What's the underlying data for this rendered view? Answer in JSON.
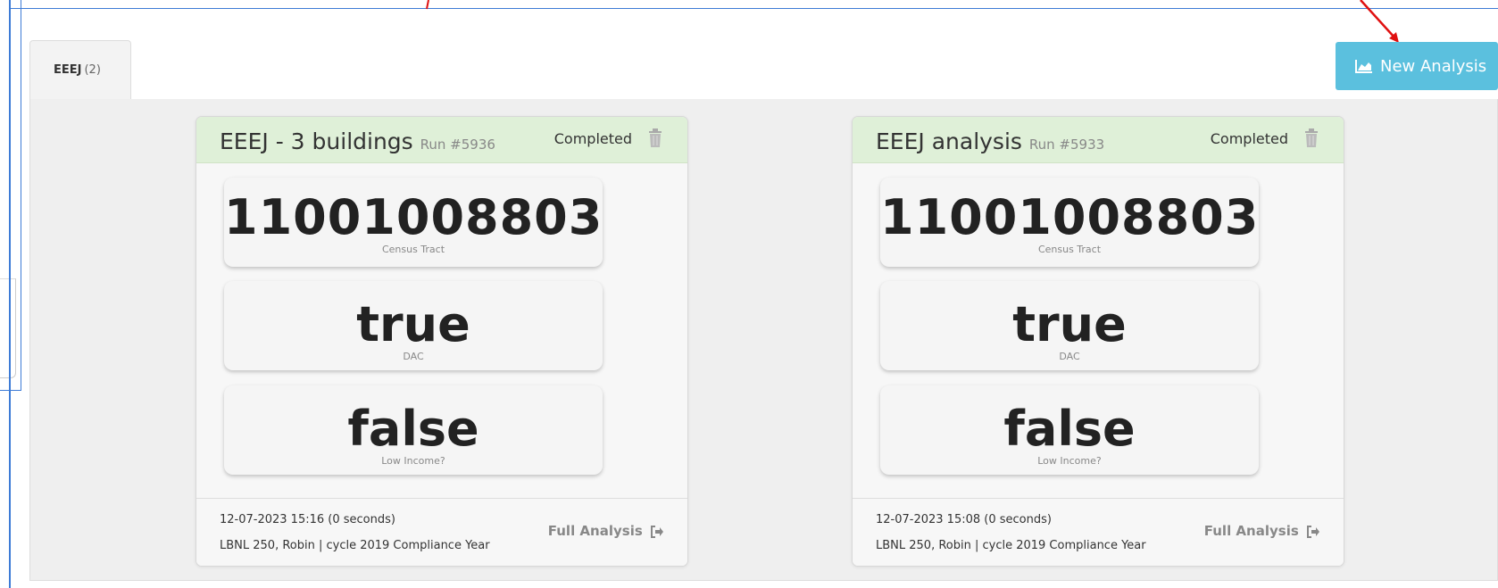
{
  "tabs": [
    {
      "label": "EEEJ",
      "count": "(2)"
    }
  ],
  "toolbar": {
    "new_analysis_label": "New Analysis"
  },
  "colors": {
    "header_green": "#dff0d8",
    "button_blue": "#5bc0de",
    "annotation_blue": "#3d7bd6",
    "annotation_red": "#e01010"
  },
  "cards": [
    {
      "title": "EEEJ - 3 buildings",
      "run": "Run #5936",
      "status": "Completed",
      "metrics": [
        {
          "value": "11001008803",
          "label": "Census Tract"
        },
        {
          "value": "true",
          "label": "DAC"
        },
        {
          "value": "false",
          "label": "Low Income?"
        }
      ],
      "date": "12-07-2023 15:16 (0 seconds)",
      "meta": "LBNL 250, Robin | cycle 2019 Compliance Year",
      "link": "Full Analysis"
    },
    {
      "title": "EEEJ analysis",
      "run": "Run #5933",
      "status": "Completed",
      "metrics": [
        {
          "value": "11001008803",
          "label": "Census Tract"
        },
        {
          "value": "true",
          "label": "DAC"
        },
        {
          "value": "false",
          "label": "Low Income?"
        }
      ],
      "date": "12-07-2023 15:08 (0 seconds)",
      "meta": "LBNL 250, Robin | cycle 2019 Compliance Year",
      "link": "Full Analysis"
    }
  ]
}
